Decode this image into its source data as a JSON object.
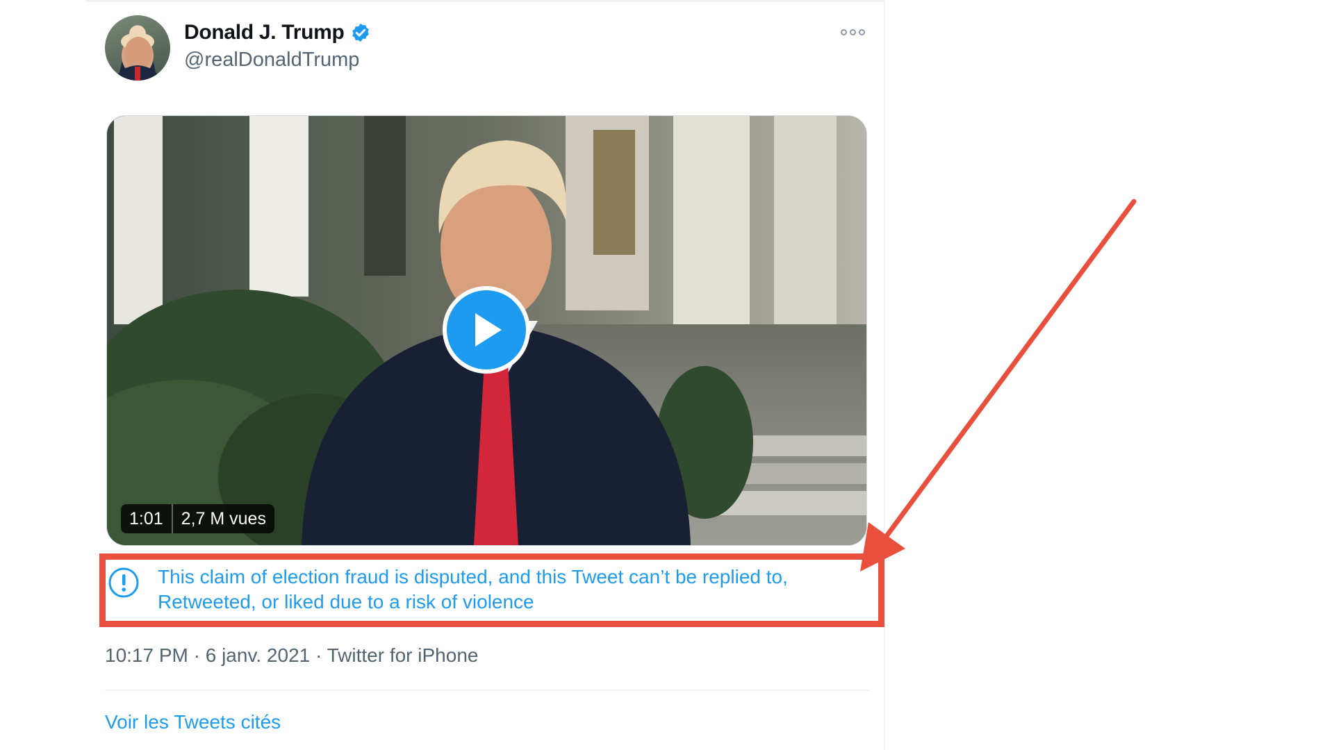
{
  "tweet": {
    "author": {
      "display_name": "Donald J. Trump",
      "handle": "@realDonaldTrump",
      "verified": true,
      "avatar_icon": "profile-photo"
    },
    "more_icon": "more-options-icon",
    "video": {
      "duration": "1:01",
      "views": "2,7 M vues",
      "play_icon": "play-icon"
    },
    "notice": {
      "icon": "exclamation-circle-icon",
      "text": "This claim of election fraud is disputed, and this Tweet can’t be replied to, Retweeted, or liked due to a risk of violence"
    },
    "timestamp": "10:17 PM · 6 janv. 2021 · Twitter for iPhone",
    "quote_link": "Voir les Tweets cités"
  },
  "colors": {
    "accent": "#1d9bf0",
    "annotation": "#e8503d",
    "secondary_text": "#536471"
  }
}
